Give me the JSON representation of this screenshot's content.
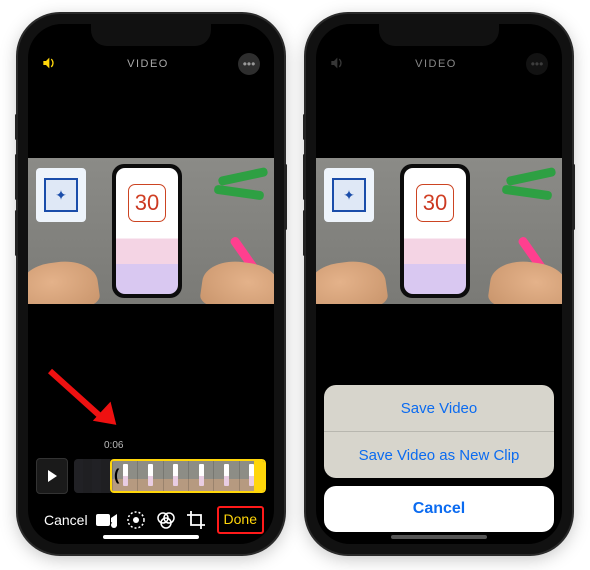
{
  "header": {
    "title": "VIDEO",
    "volume_icon": "volume-icon",
    "more_icon": "more-icon"
  },
  "preview": {
    "display_number": "30"
  },
  "timeline": {
    "time_label": "0:06"
  },
  "toolbar": {
    "cancel_label": "Cancel",
    "done_label": "Done"
  },
  "action_sheet": {
    "save_label": "Save Video",
    "save_new_label": "Save Video as New Clip",
    "cancel_label": "Cancel"
  }
}
